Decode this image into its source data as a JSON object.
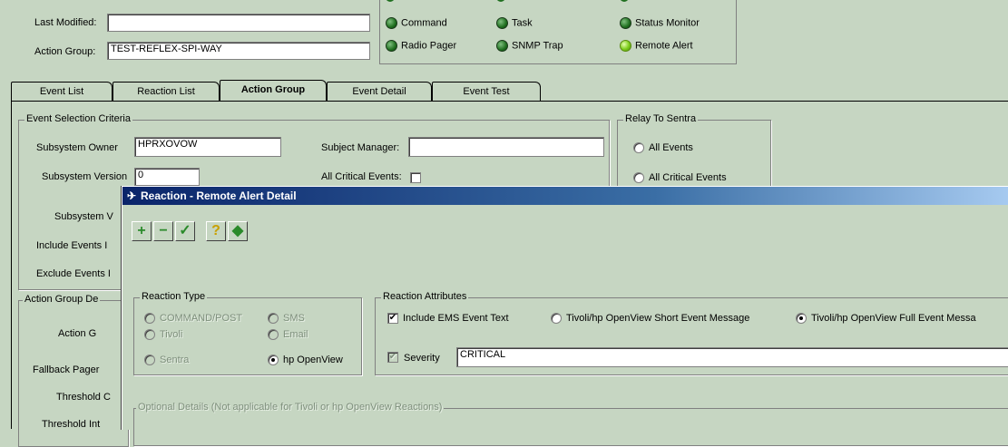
{
  "header": {
    "last_modified_label": "Last Modified:",
    "last_modified_value": "",
    "action_group_label": "Action Group:",
    "action_group_value": "TEST-REFLEX-SPI-WAY"
  },
  "status": {
    "items": [
      {
        "label": "Command",
        "state": "off"
      },
      {
        "label": "Task",
        "state": "off"
      },
      {
        "label": "Status Monitor",
        "state": "off"
      },
      {
        "label": "Radio Pager",
        "state": "off"
      },
      {
        "label": "SNMP Trap",
        "state": "off"
      },
      {
        "label": "Remote Alert",
        "state": "on"
      }
    ]
  },
  "tabs": [
    {
      "label": "Event List"
    },
    {
      "label": "Reaction List"
    },
    {
      "label": "Action Group",
      "active": true
    },
    {
      "label": "Event Detail"
    },
    {
      "label": "Event Test"
    }
  ],
  "criteria": {
    "title": "Event Selection Criteria",
    "subsystem_owner_label": "Subsystem Owner",
    "subsystem_owner_value": "HPRXOVOW",
    "subject_manager_label": "Subject Manager:",
    "subject_manager_value": "",
    "subsystem_version_label": "Subsystem Version",
    "subsystem_version_value": "0",
    "all_critical_label": "All Critical Events:",
    "subsystem_v_label": "Subsystem V",
    "include_events_label": "Include Events I",
    "exclude_events_label": "Exclude Events I"
  },
  "relay": {
    "title": "Relay To Sentra",
    "all_events": "All Events",
    "all_critical_events": "All Critical Events"
  },
  "action_group_detail": {
    "title": "Action Group De",
    "action_g_label": "Action G",
    "fallback_pager_label": "Fallback Pager",
    "threshold_c_label": "Threshold C",
    "threshold_int_label": "Threshold Int"
  },
  "modal": {
    "title": "Reaction - Remote Alert Detail",
    "toolbar": {
      "add_label": "+",
      "remove_label": "−",
      "accept_label": "✓",
      "help_label": "?",
      "exit_label": "◆"
    },
    "reaction_type": {
      "title": "Reaction Type",
      "options": [
        {
          "label": "COMMAND/POST",
          "selected": false,
          "disabled": true
        },
        {
          "label": "SMS",
          "selected": false,
          "disabled": true
        },
        {
          "label": "Tivoli",
          "selected": false,
          "disabled": true
        },
        {
          "label": "Email",
          "selected": false,
          "disabled": true
        },
        {
          "label": "Sentra",
          "selected": false,
          "disabled": true
        },
        {
          "label": "hp OpenView",
          "selected": true,
          "disabled": false
        }
      ]
    },
    "reaction_attributes": {
      "title": "Reaction Attributes",
      "include_ems_label": "Include EMS Event Text",
      "include_ems_checked": true,
      "short_msg_label": "Tivoli/hp OpenView Short Event Message",
      "full_msg_label": "Tivoli/hp OpenView Full Event Messa",
      "full_msg_selected": true,
      "severity_label": "Severity",
      "severity_value": "CRITICAL",
      "severity_checked": true
    },
    "optional_details_title": "Optional Details (Not applicable for Tivoli or hp OpenView Reactions)"
  },
  "colors": {
    "window_bg": "#c6d6c2",
    "titlebar_start": "#0a246a",
    "titlebar_end": "#a6caf0",
    "led_on": "#7ccc1a",
    "led_off": "#1f6f1f"
  }
}
